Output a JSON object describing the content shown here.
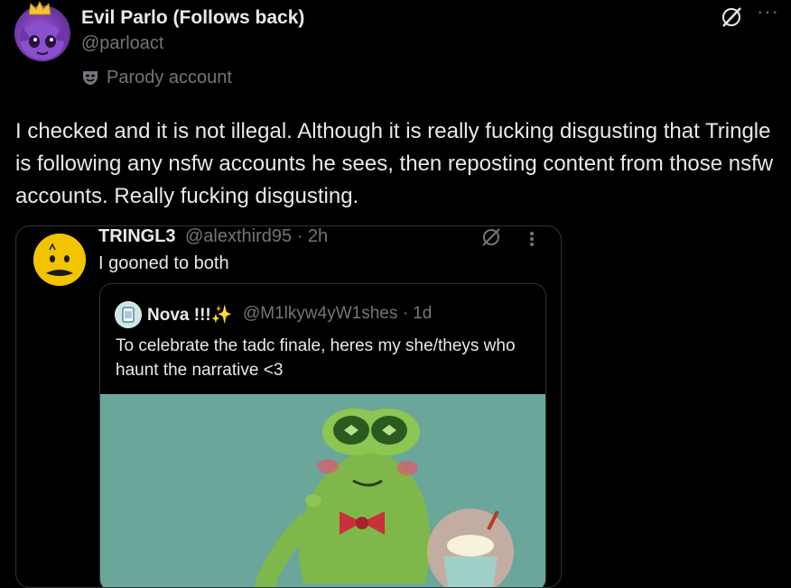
{
  "post": {
    "author_name": "Evil Parlo (Follows back)",
    "handle": "@parloact",
    "parody_label": "Parody account",
    "text": "I checked and it is not illegal. Although it is really fucking disgusting that Tringle is following any nsfw accounts he sees, then reposting content from those nsfw accounts. Really fucking disgusting."
  },
  "embedded": {
    "author_name": "TRINGL3",
    "meta": "@alexthird95 · 2h",
    "text": "I gooned to both",
    "quote": {
      "author_name": "Nova !!!✨",
      "meta": "@M1lkyw4yW1shes · 1d",
      "text": "To celebrate the tadc finale, heres my she/theys who haunt the narrative <3"
    }
  },
  "icons": [
    "crown-icon",
    "parody-mask-icon",
    "grok-icon",
    "more-icon"
  ],
  "colors": {
    "background": "#000000",
    "text": "#e7e9ea",
    "secondary": "#71767b",
    "border": "#2f3336"
  }
}
